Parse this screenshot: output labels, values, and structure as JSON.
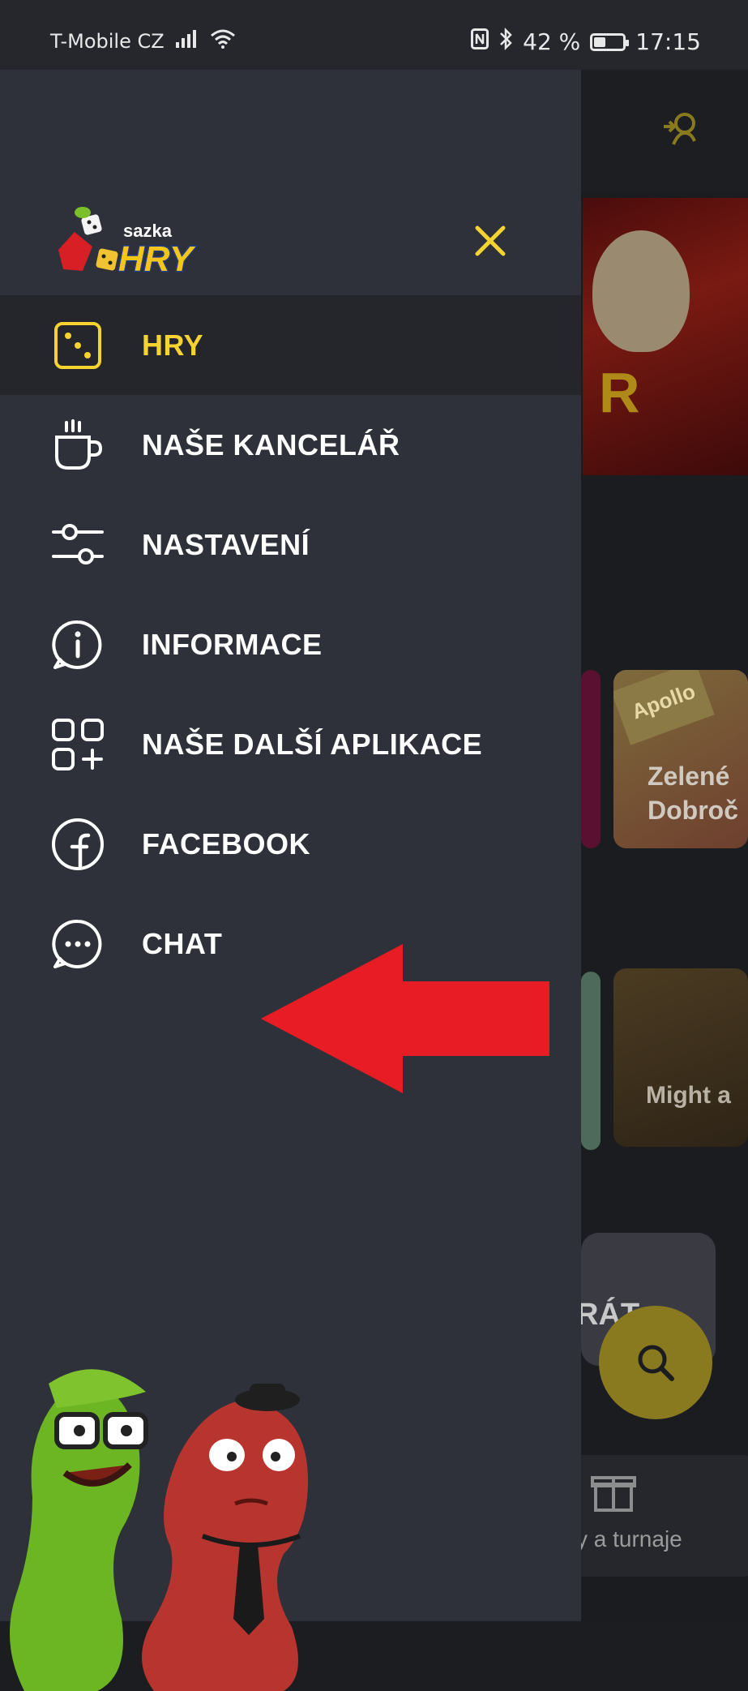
{
  "status_bar": {
    "carrier": "T-Mobile CZ",
    "battery_percent": "42 %",
    "battery_level": 0.42,
    "time": "17:15"
  },
  "logo": {
    "small_text": "sazka",
    "main_text": "HRY"
  },
  "drawer": {
    "close_icon": "close-icon",
    "menu_items": [
      {
        "label": "HRY",
        "icon": "dice-icon",
        "active": true
      },
      {
        "label": "NAŠE KANCELÁŘ",
        "icon": "coffee-cup-icon",
        "active": false
      },
      {
        "label": "NASTAVENÍ",
        "icon": "sliders-icon",
        "active": false
      },
      {
        "label": "INFORMACE",
        "icon": "info-icon",
        "active": false
      },
      {
        "label": "NAŠE DALŠÍ APLIKACE",
        "icon": "apps-grid-icon",
        "active": false
      },
      {
        "label": "FACEBOOK",
        "icon": "facebook-icon",
        "active": false
      },
      {
        "label": "CHAT",
        "icon": "chat-icon",
        "active": false
      }
    ]
  },
  "background_app": {
    "tile_jackpot_badge": "Apollo",
    "tile_game_name": "Zelené\nDobroč",
    "tile_game_name_2": "Might a",
    "card_label": "RÁT",
    "bottom_nav_label": "sy a turnaje"
  },
  "colors": {
    "drawer_bg": "#2e3139",
    "accent_yellow": "#f5d331",
    "arrow_red": "#e81c24"
  }
}
